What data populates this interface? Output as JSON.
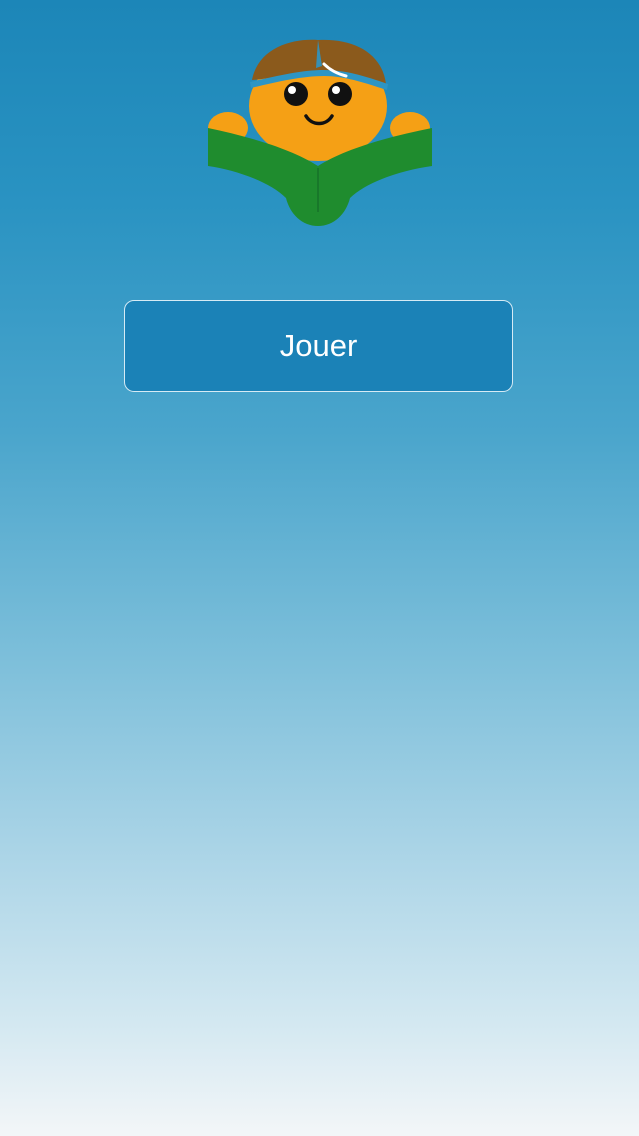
{
  "screen": {
    "background_top": "#1c86b8",
    "background_bottom": "#f3f6f8"
  },
  "logo": {
    "icon": "child-reading-book-icon",
    "colors": {
      "face": "#f5a015",
      "hair": "#8b5a1c",
      "book": "#1f8c2e",
      "headband": "#2d95c4"
    }
  },
  "play_button": {
    "label": "Jouer",
    "color": "#1b82b7"
  }
}
